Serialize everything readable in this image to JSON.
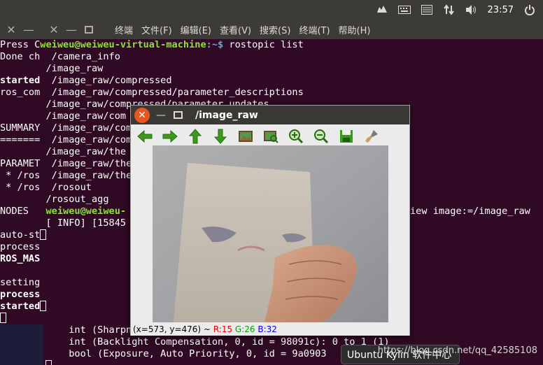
{
  "top_panel": {
    "clock": "23:57",
    "icons": [
      "indicator-kylin-icon",
      "keyboard-icon",
      "mail-icon",
      "network-updown-icon",
      "volume-icon",
      "power-icon"
    ]
  },
  "terminal": {
    "menu": [
      "终端",
      "文件(F)",
      "编辑(E)",
      "查看(V)",
      "搜索(S)",
      "终端(T)",
      "帮助(H)"
    ],
    "prompt_user": "weiweu@weiweu-virtual-machine",
    "prompt_path": ":~$",
    "prompt_cmd": " rostopic list",
    "prompt_user2": "weiweu@weiweu-",
    "left_col": [
      "Press C",
      "Done ch",
      "",
      "started",
      "ros_com",
      "",
      "",
      "SUMMARY",
      "=======",
      "",
      "PARAMET",
      " * /ros",
      " * /ros",
      "",
      "NODES",
      "",
      "auto-st",
      "process",
      "ROS_MAS",
      "",
      "setting",
      "process",
      "started"
    ],
    "bold_lines": [
      3,
      17,
      18,
      20,
      21
    ],
    "topics": [
      "/camera_info",
      "/image_raw",
      "/image_raw/compressed",
      "/image_raw/compressed/parameter_descriptions",
      "/image_raw/compressed/parameter_updates",
      "/image_raw/com",
      "/image_raw/com",
      "/image_raw/com",
      "/image_raw/the",
      "/image_raw/the",
      "/image_raw/the",
      "/rosout",
      "/rosout_agg"
    ],
    "info_line": "[ INFO] [15845",
    "right_text": "iew image:=/image_raw",
    "bottom_lines": [
      "int (Sharpne",
      "int (Backlight Compensation, 0, id = 98091c): 0 to 1 (1)",
      "bool (Exposure, Auto Priority, 0, id = 9a0903"
    ]
  },
  "image_window": {
    "title": "/image_raw",
    "toolbar": [
      "back-arrow-icon",
      "forward-arrow-icon",
      "up-arrow-icon",
      "down-arrow-icon",
      "image-fit-icon",
      "image-view-icon",
      "zoom-in-icon",
      "zoom-out-icon",
      "save-icon",
      "brush-icon"
    ],
    "status": {
      "coords": "(x=573, y=476) ~",
      "r": "R:15",
      "g": "G:26",
      "b": "B:32"
    }
  },
  "watermark": "https://blog.csdn.net/qq_42585108",
  "kylin_popup": "Ubuntu Kylin 软件中心"
}
